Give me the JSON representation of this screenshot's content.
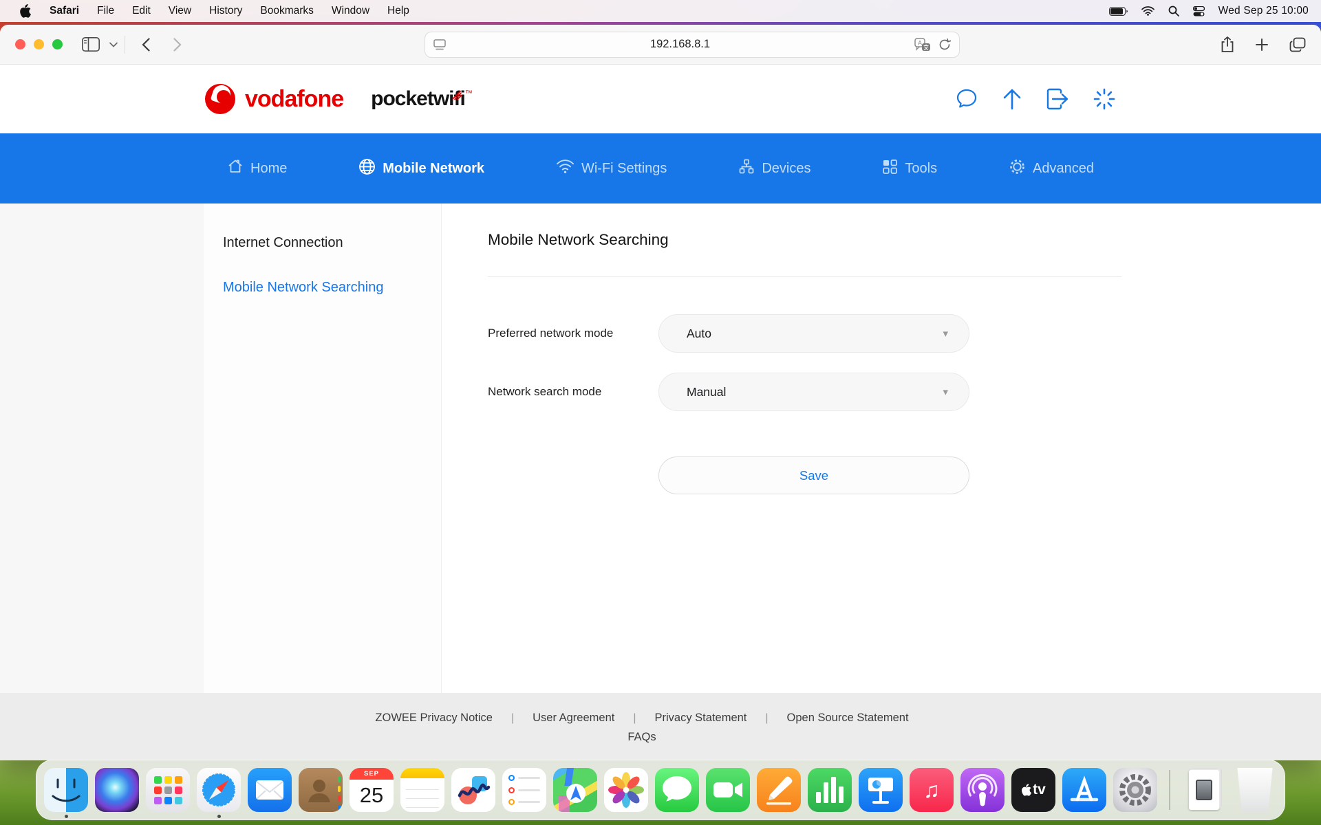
{
  "colors": {
    "accent_blue": "#1777e8",
    "vodafone_red": "#e60000",
    "nav_bg": "#1777e8",
    "footer_bg": "#ececec"
  },
  "menu_bar": {
    "app_name": "Safari",
    "items": [
      "File",
      "Edit",
      "View",
      "History",
      "Bookmarks",
      "Window",
      "Help"
    ],
    "clock": "Wed Sep 25 10:00",
    "status_icons": [
      "battery-icon",
      "wifi-icon",
      "search-icon",
      "control-center-icon"
    ]
  },
  "toolbar": {
    "url": "192.168.8.1",
    "icons": [
      "sidebar-icon",
      "chevron-down-icon",
      "back-icon",
      "forward-icon",
      "page-icon",
      "translate-icon",
      "reload-icon",
      "share-icon",
      "new-tab-icon",
      "tabs-icon"
    ]
  },
  "brand": {
    "logo_text": "vodafone",
    "product_prefix": "pocket",
    "product_suffix": "wifi",
    "trademark": "™"
  },
  "header_icons": [
    "chat-icon",
    "upload-icon",
    "logout-icon",
    "loading-spinner-icon"
  ],
  "nav": {
    "items": [
      {
        "label": "Home",
        "icon": "home-icon",
        "active": false
      },
      {
        "label": "Mobile Network",
        "icon": "globe-icon",
        "active": true
      },
      {
        "label": "Wi-Fi Settings",
        "icon": "wifi-icon",
        "active": false
      },
      {
        "label": "Devices",
        "icon": "devices-icon",
        "active": false
      },
      {
        "label": "Tools",
        "icon": "tools-grid-icon",
        "active": false
      },
      {
        "label": "Advanced",
        "icon": "gear-icon",
        "active": false
      }
    ]
  },
  "sidebar": {
    "items": [
      {
        "label": "Internet Connection",
        "active": false
      },
      {
        "label": "Mobile Network Searching",
        "active": true
      }
    ]
  },
  "main": {
    "title": "Mobile Network Searching",
    "fields": [
      {
        "label": "Preferred network mode",
        "value": "Auto",
        "caret": "▾"
      },
      {
        "label": "Network search mode",
        "value": "Manual",
        "caret": "▾"
      }
    ],
    "save_label": "Save"
  },
  "footer": {
    "links": [
      "ZOWEE Privacy Notice",
      "User Agreement",
      "Privacy Statement",
      "Open Source Statement"
    ],
    "separator": "|",
    "faq_label": "FAQs"
  },
  "dock": {
    "apps": [
      "finder",
      "siri",
      "launchpad",
      "safari",
      "mail",
      "contacts",
      "calendar",
      "notes",
      "freeform",
      "reminders",
      "maps",
      "photos",
      "messages",
      "facetime",
      "pages",
      "numbers",
      "keynote",
      "music",
      "podcasts",
      "tv",
      "app-store",
      "system-settings",
      "documents",
      "trash"
    ],
    "running": [
      "finder",
      "safari"
    ],
    "calendar_month": "SEP",
    "calendar_day": "25",
    "tv_label": "tv",
    "music_glyph": "♫"
  }
}
